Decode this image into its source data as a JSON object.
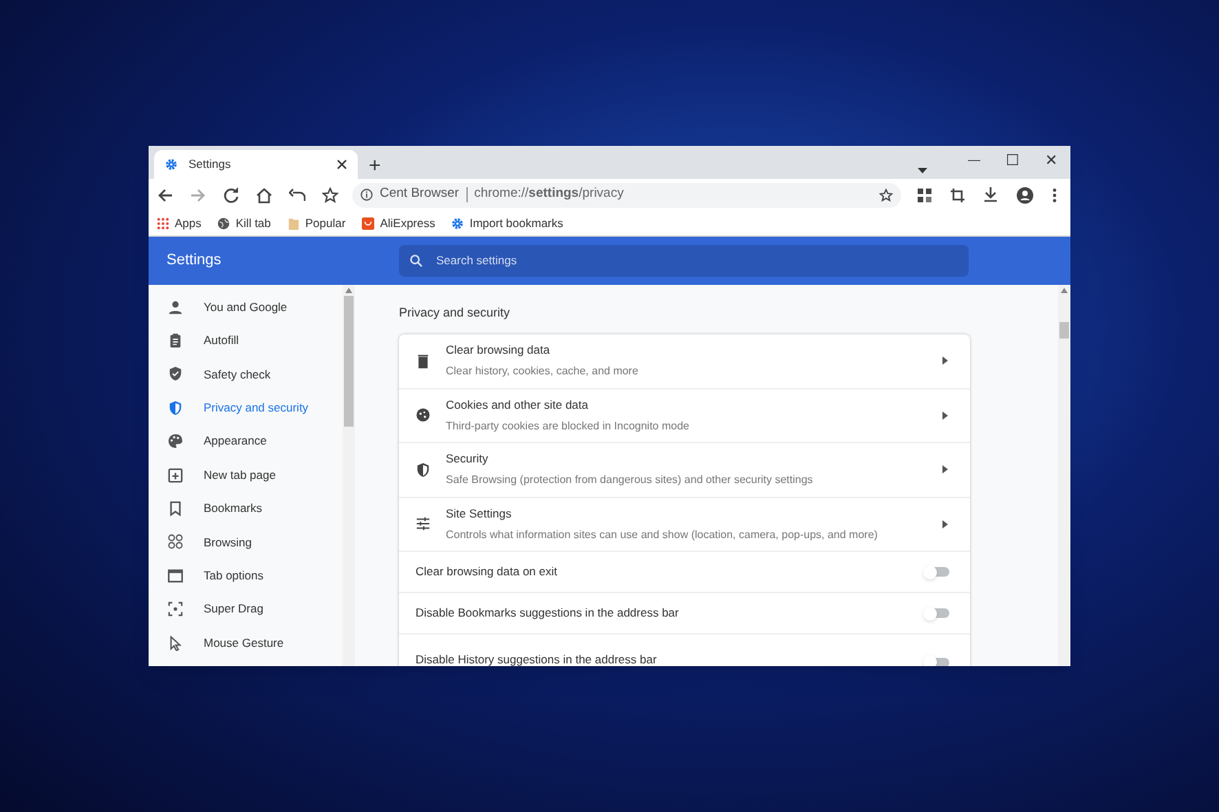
{
  "tab": {
    "title": "Settings",
    "selected": true
  },
  "window_controls": {
    "minimize": "—",
    "maximize": "☐",
    "close": "✕"
  },
  "new_tab": "+",
  "address_bar": {
    "site": "Cent Browser",
    "url": "chrome://**settings**/privacy"
  },
  "bookmarks": [
    {
      "label": "Apps",
      "kind": "apps"
    },
    {
      "label": "Kill tab",
      "kind": "globe"
    },
    {
      "label": "Popular",
      "kind": "folder"
    },
    {
      "label": "AliExpress",
      "kind": "shop"
    },
    {
      "label": "Import bookmarks",
      "kind": "gear"
    }
  ],
  "header": {
    "title": "Settings",
    "search_placeholder": "Search settings"
  },
  "sidebar": {
    "items": [
      {
        "label": "You and Google",
        "kind": "person",
        "selected": false
      },
      {
        "label": "Autofill",
        "kind": "clipboard",
        "selected": false
      },
      {
        "label": "Safety check",
        "kind": "shield",
        "selected": false
      },
      {
        "label": "Privacy and security",
        "kind": "shield-half",
        "selected": true
      },
      {
        "label": "Appearance",
        "kind": "palette",
        "selected": false
      },
      {
        "label": "New tab page",
        "kind": "newtab",
        "selected": false
      },
      {
        "label": "Bookmarks",
        "kind": "bookmark",
        "selected": false
      },
      {
        "label": "Browsing",
        "kind": "browsing",
        "selected": false
      },
      {
        "label": "Tab options",
        "kind": "window",
        "selected": false
      },
      {
        "label": "Super Drag",
        "kind": "drag",
        "selected": false
      },
      {
        "label": "Mouse Gesture",
        "kind": "pointer",
        "selected": false
      }
    ]
  },
  "section": {
    "title": "Privacy and security",
    "rows": [
      {
        "kind": "link",
        "title": "Clear browsing data",
        "subtitle": "Clear history, cookies, cache, and more"
      },
      {
        "kind": "link",
        "title": "Cookies and other site data",
        "subtitle": "Third-party cookies are blocked in Incognito mode"
      },
      {
        "kind": "link",
        "title": "Security",
        "subtitle": "Safe Browsing (protection from dangerous sites) and other security settings"
      },
      {
        "kind": "link",
        "title": "Site Settings",
        "subtitle": "Controls what information sites can use and show (location, camera, pop-ups, and more)"
      },
      {
        "kind": "toggle",
        "title": "Clear browsing data on exit",
        "on": false
      },
      {
        "kind": "toggle",
        "title": "Disable Bookmarks suggestions in the address bar",
        "on": false
      },
      {
        "kind": "toggle",
        "title": "Disable History suggestions in the address bar",
        "on": false
      }
    ]
  }
}
